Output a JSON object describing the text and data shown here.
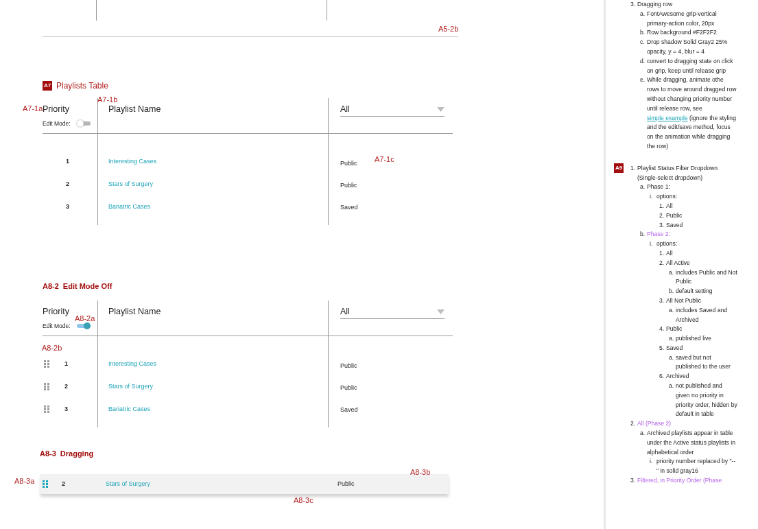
{
  "top_fragment": {
    "annotation": "A5-2b"
  },
  "playlists_table": {
    "badge": "A7",
    "title": "Playlists Table",
    "annotations": {
      "priority": "A7-1a",
      "name": "A7-1b",
      "status": "A7-1c"
    },
    "columns": [
      "Priority",
      "Playlist Name"
    ],
    "edit_mode": {
      "label": "Edit Mode:",
      "on": false
    },
    "filter": {
      "value": "All"
    },
    "rows": [
      {
        "priority": "1",
        "name": "Interesting Cases",
        "status": "Public"
      },
      {
        "priority": "2",
        "name": "Stars of Surgery",
        "status": "Public"
      },
      {
        "priority": "3",
        "name": "Bariatric Cases",
        "status": "Saved"
      }
    ]
  },
  "edit_mode_table": {
    "label": "A8-2",
    "title": "Edit Mode Off",
    "annotations": {
      "toggle": "A8-2a",
      "grip": "A8-2b"
    },
    "columns": [
      "Priority",
      "Playlist Name"
    ],
    "edit_mode": {
      "label": "Edit Mode:",
      "on": true
    },
    "filter": {
      "value": "All"
    },
    "rows": [
      {
        "priority": "1",
        "name": "Interesting Cases",
        "status": "Public"
      },
      {
        "priority": "2",
        "name": "Stars of Surgery",
        "status": "Public"
      },
      {
        "priority": "3",
        "name": "Bariatric Cases",
        "status": "Saved"
      }
    ]
  },
  "dragging": {
    "label": "A8-3",
    "title": "Dragging",
    "annotations": {
      "grip": "A8-3a",
      "row": "A8-3b",
      "shadow": "A8-3c"
    },
    "row": {
      "priority": "2",
      "name": "Stars of Surgery",
      "status": "Public",
      "dragging": true
    }
  },
  "notes": [
    {
      "items": [
        {
          "marker": "3.",
          "text": "Dragging row",
          "future": false,
          "children": [
            {
              "marker": "a.",
              "text": "FontAwesome grip-vertical primary-action color, 20px",
              "future": false
            },
            {
              "marker": "b.",
              "text": "Row background #F2F2F2",
              "future": false
            },
            {
              "marker": "c.",
              "text": "Drop shadow Solid Gray2 25% opacity, y = 4, blur = 4",
              "future": false
            },
            {
              "marker": "d.",
              "text": "convert to dragging state on click on grip, keep until release grip",
              "future": false
            },
            {
              "marker": "e.",
              "text": "While dragging, animate othe rows to move around dragged row without changing priority number until release row, see",
              "link": "simple example",
              "text_after": "(ignore the styling and the edit/save method, focus on the animation while dragging the row)",
              "future": false
            }
          ]
        }
      ]
    },
    {
      "badge": "A9",
      "items": [
        {
          "marker": "1.",
          "text": "Playlist Status Filter Dropdown (Single-select dropdown)",
          "future": false,
          "children": [
            {
              "marker": "a.",
              "text": "Phase 1:",
              "future": false,
              "children": [
                {
                  "marker": "i.",
                  "text": "options:",
                  "future": false,
                  "children": [
                    {
                      "marker": "1.",
                      "text": "All",
                      "future": false
                    },
                    {
                      "marker": "2.",
                      "text": "Public",
                      "future": false
                    },
                    {
                      "marker": "3.",
                      "text": "Saved",
                      "future": false
                    }
                  ]
                }
              ]
            },
            {
              "marker": "b.",
              "text": "Phase 2:",
              "future": true,
              "children": [
                {
                  "marker": "i.",
                  "text": "options:",
                  "future": false,
                  "children": [
                    {
                      "marker": "1.",
                      "text": "All",
                      "future": false
                    },
                    {
                      "marker": "2.",
                      "text": "All Active",
                      "future": false,
                      "children": [
                        {
                          "marker": "a.",
                          "text": "includes Public and Not Public",
                          "future": false
                        },
                        {
                          "marker": "b.",
                          "text": "default setting",
                          "future": false
                        }
                      ]
                    },
                    {
                      "marker": "3.",
                      "text": "All Not Public",
                      "future": false,
                      "children": [
                        {
                          "marker": "a.",
                          "text": "includes Saved and Archived",
                          "future": false
                        }
                      ]
                    },
                    {
                      "marker": "4.",
                      "text": "Public",
                      "future": false,
                      "children": [
                        {
                          "marker": "a.",
                          "text": "published live",
                          "future": false
                        }
                      ]
                    },
                    {
                      "marker": "5.",
                      "text": "Saved",
                      "future": false,
                      "children": [
                        {
                          "marker": "a.",
                          "text": "saved but not published to the user",
                          "future": false
                        }
                      ]
                    },
                    {
                      "marker": "6.",
                      "text": "Archived",
                      "future": false,
                      "children": [
                        {
                          "marker": "a.",
                          "text": "not published and given no priority in priority order, hidden by default in table",
                          "future": false
                        }
                      ]
                    }
                  ]
                }
              ]
            }
          ]
        },
        {
          "marker": "2.",
          "text": "All (Phase 2)",
          "future": true,
          "children": [
            {
              "marker": "a.",
              "text": "Archived playlists appear in table under the Active status playlists in alphabetical order",
              "future": false,
              "children": [
                {
                  "marker": "i.",
                  "text": "priority number replaced by \"--\" in solid gray16",
                  "future": false
                }
              ]
            }
          ]
        },
        {
          "marker": "3.",
          "text": "Filtered, in Priority Order (Phase",
          "future": true
        }
      ]
    }
  ]
}
